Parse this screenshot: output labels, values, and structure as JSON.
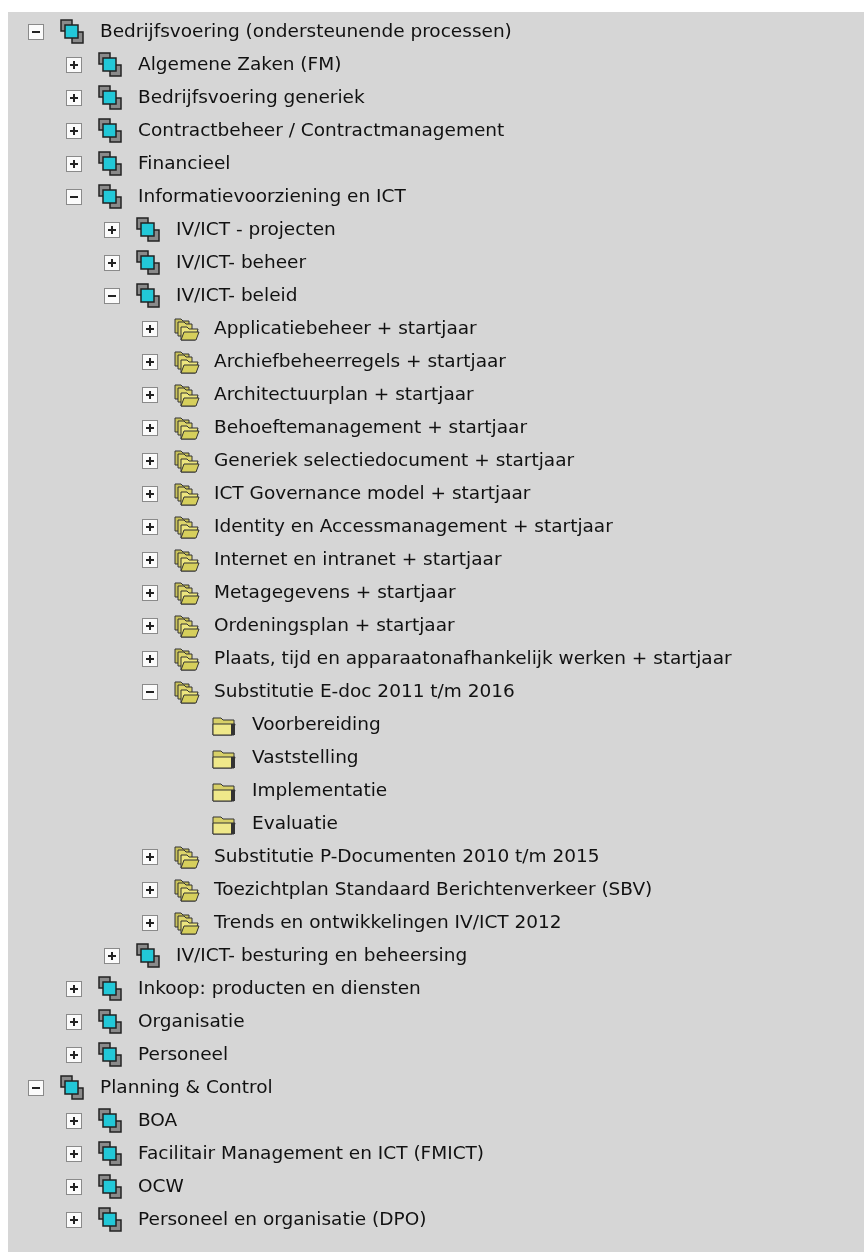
{
  "tree": [
    {
      "label": "Bedrijfsvoering (ondersteunende processen)",
      "kind": "group",
      "expanded": true,
      "children": [
        {
          "label": "Algemene Zaken (FM)",
          "kind": "group",
          "expanded": false
        },
        {
          "label": "Bedrijfsvoering generiek",
          "kind": "group",
          "expanded": false
        },
        {
          "label": "Contractbeheer / Contractmanagement",
          "kind": "group",
          "expanded": false
        },
        {
          "label": "Financieel",
          "kind": "group",
          "expanded": false
        },
        {
          "label": "Informatievoorziening en ICT",
          "kind": "group",
          "expanded": true,
          "children": [
            {
              "label": "IV/ICT - projecten",
              "kind": "group",
              "expanded": false
            },
            {
              "label": "IV/ICT- beheer",
              "kind": "group",
              "expanded": false
            },
            {
              "label": "IV/ICT- beleid",
              "kind": "group",
              "expanded": true,
              "children": [
                {
                  "label": "Applicatiebeheer + startjaar",
                  "kind": "folders",
                  "expanded": false
                },
                {
                  "label": "Archiefbeheerregels + startjaar",
                  "kind": "folders",
                  "expanded": false
                },
                {
                  "label": "Architectuurplan + startjaar",
                  "kind": "folders",
                  "expanded": false
                },
                {
                  "label": "Behoeftemanagement + startjaar",
                  "kind": "folders",
                  "expanded": false
                },
                {
                  "label": "Generiek selectiedocument + startjaar",
                  "kind": "folders",
                  "expanded": false
                },
                {
                  "label": "ICT Governance model + startjaar",
                  "kind": "folders",
                  "expanded": false
                },
                {
                  "label": "Identity en Accessmanagement + startjaar",
                  "kind": "folders",
                  "expanded": false
                },
                {
                  "label": "Internet en intranet + startjaar",
                  "kind": "folders",
                  "expanded": false
                },
                {
                  "label": "Metagegevens + startjaar",
                  "kind": "folders",
                  "expanded": false
                },
                {
                  "label": "Ordeningsplan + startjaar",
                  "kind": "folders",
                  "expanded": false
                },
                {
                  "label": "Plaats, tijd en apparaatonafhankelijk werken + startjaar",
                  "kind": "folders",
                  "expanded": false
                },
                {
                  "label": "Substitutie E-doc 2011 t/m 2016",
                  "kind": "folders",
                  "expanded": true,
                  "children": [
                    {
                      "label": "Voorbereiding",
                      "kind": "folder"
                    },
                    {
                      "label": "Vaststelling",
                      "kind": "folder"
                    },
                    {
                      "label": "Implementatie",
                      "kind": "folder"
                    },
                    {
                      "label": "Evaluatie",
                      "kind": "folder"
                    }
                  ]
                },
                {
                  "label": "Substitutie P-Documenten 2010 t/m 2015",
                  "kind": "folders",
                  "expanded": false
                },
                {
                  "label": "Toezichtplan Standaard Berichtenverkeer (SBV)",
                  "kind": "folders",
                  "expanded": false
                },
                {
                  "label": "Trends en ontwikkelingen IV/ICT 2012",
                  "kind": "folders",
                  "expanded": false
                }
              ]
            },
            {
              "label": "IV/ICT- besturing en beheersing",
              "kind": "group",
              "expanded": false
            }
          ]
        },
        {
          "label": "Inkoop: producten en diensten",
          "kind": "group",
          "expanded": false
        },
        {
          "label": "Organisatie",
          "kind": "group",
          "expanded": false
        },
        {
          "label": "Personeel",
          "kind": "group",
          "expanded": false
        }
      ]
    },
    {
      "label": "Planning & Control",
      "kind": "group",
      "expanded": true,
      "children": [
        {
          "label": "BOA",
          "kind": "group",
          "expanded": false
        },
        {
          "label": "Facilitair Management en ICT (FMICT)",
          "kind": "group",
          "expanded": false
        },
        {
          "label": "OCW",
          "kind": "group",
          "expanded": false
        },
        {
          "label": "Personeel en organisatie (DPO)",
          "kind": "group",
          "expanded": false
        }
      ]
    }
  ]
}
